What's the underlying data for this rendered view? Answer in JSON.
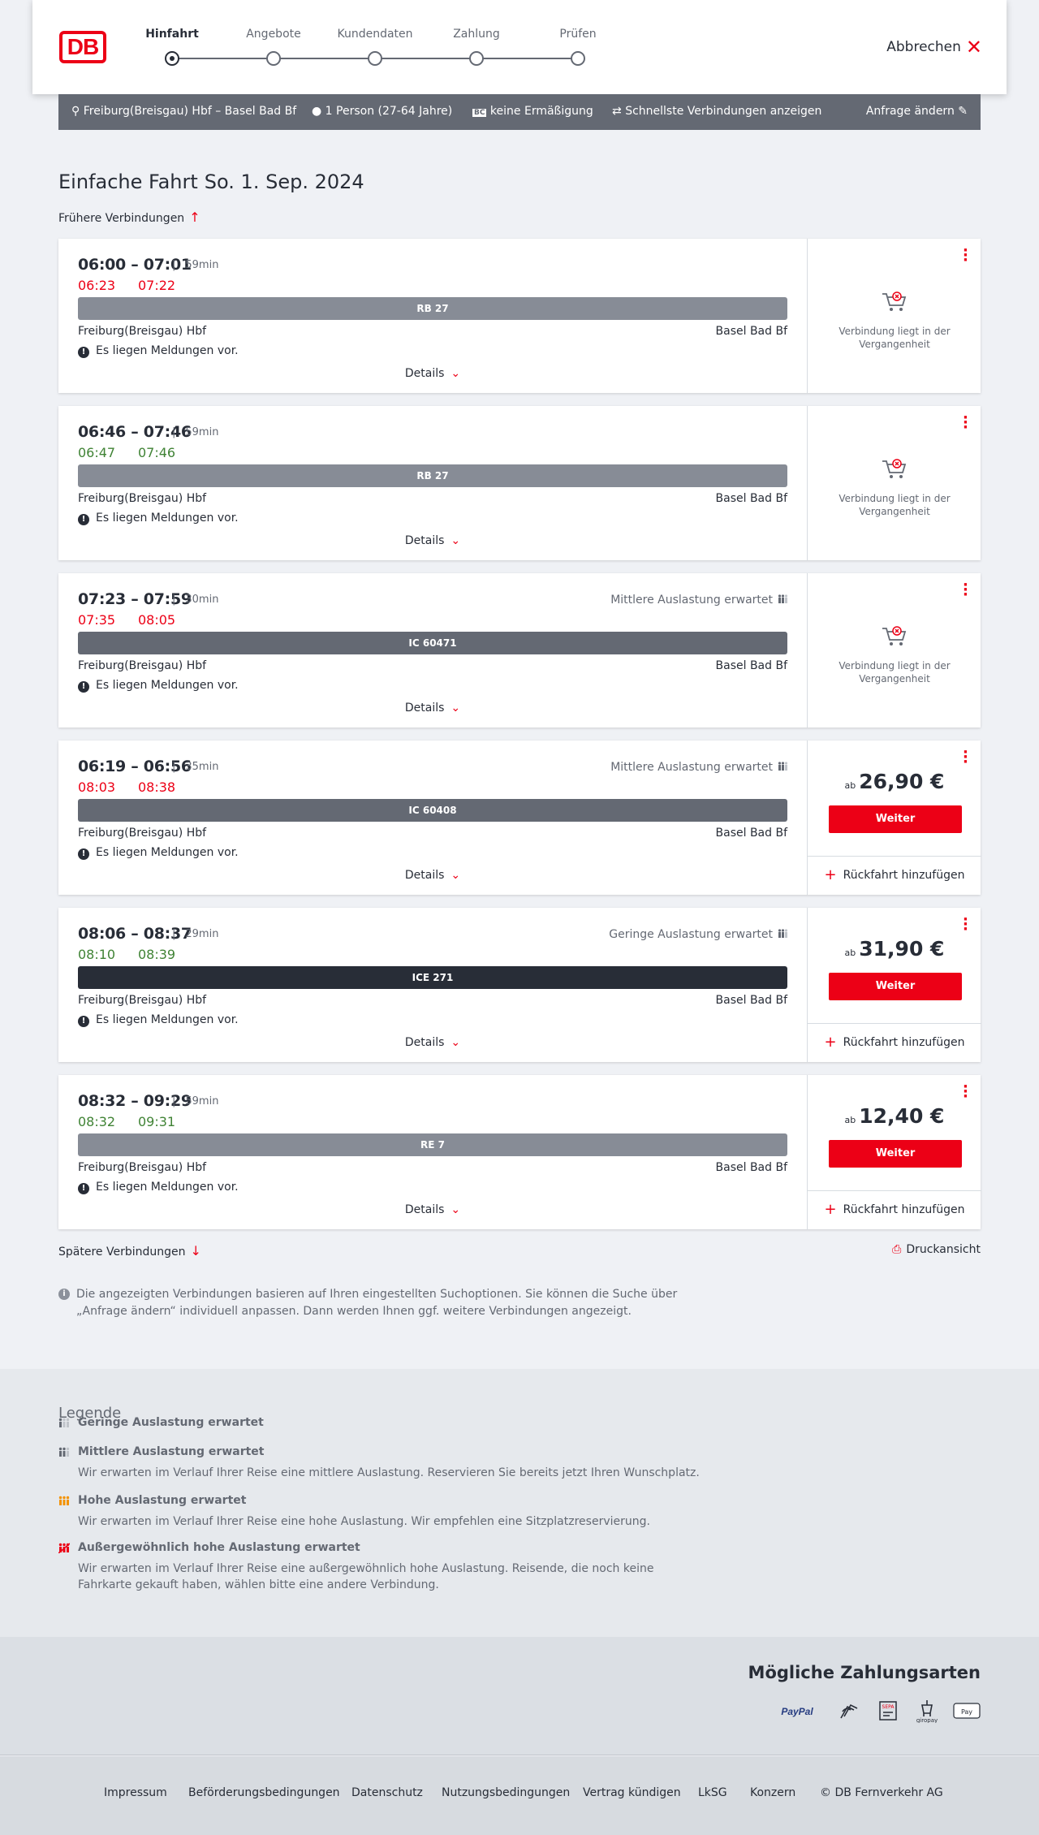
{
  "header": {
    "logo": "DB",
    "steps": [
      {
        "label": "Hinfahrt",
        "active": true
      },
      {
        "label": "Angebote",
        "active": false
      },
      {
        "label": "Kundendaten",
        "active": false
      },
      {
        "label": "Zahlung",
        "active": false
      },
      {
        "label": "Prüfen",
        "active": false
      }
    ],
    "cancel_label": "Abbrechen"
  },
  "search_bar": {
    "route": "Freiburg(Breisgau) Hbf – Basel Bad Bf",
    "passengers": "1 Person (27-64 Jahre)",
    "discount": "keine Ermäßigung",
    "fastest": "Schnellste Verbindungen anzeigen",
    "change": "Anfrage ändern"
  },
  "page": {
    "title": "Einfache Fahrt",
    "date": "So. 1. Sep. 2024",
    "earlier": "Frühere Verbindungen",
    "later": "Spätere Verbindungen",
    "print": "Druckansicht",
    "info": "Die angezeigten Verbindungen basieren auf Ihren eingestellten Suchoptionen. Sie können die Suche über „Anfrage ändern“ individuell anpassen. Dann werden Ihnen ggf. weitere Verbindungen angezeigt."
  },
  "connections": [
    {
      "times": "06:00 – 07:01",
      "duration": "59min",
      "rt_dep": "06:23",
      "rt_arr": "07:22",
      "rt_status": "late",
      "load": "",
      "train": "RB 27",
      "train_color": "#878c96",
      "from": "Freiburg(Breisgau) Hbf",
      "to": "Basel Bad Bf",
      "message": "Es liegen Meldungen vor.",
      "details": "Details",
      "past_text": "Verbindung liegt in der Vergangenheit"
    },
    {
      "times": "06:46 – 07:46",
      "duration": "59min",
      "rt_dep": "06:47",
      "rt_arr": "07:46",
      "rt_status": "ontime",
      "load": "",
      "train": "RB 27",
      "train_color": "#878c96",
      "from": "Freiburg(Breisgau) Hbf",
      "to": "Basel Bad Bf",
      "message": "Es liegen Meldungen vor.",
      "details": "Details",
      "past_text": "Verbindung liegt in der Vergangenheit"
    },
    {
      "times": "07:23 – 07:59",
      "duration": "30min",
      "rt_dep": "07:35",
      "rt_arr": "08:05",
      "rt_status": "late",
      "load": "Mittlere Auslastung erwartet",
      "train": "IC 60471",
      "train_color": "#646973",
      "from": "Freiburg(Breisgau) Hbf",
      "to": "Basel Bad Bf",
      "message": "Es liegen Meldungen vor.",
      "details": "Details",
      "past_text": "Verbindung liegt in der Vergangenheit"
    },
    {
      "times": "06:19 – 06:56",
      "duration": "35min",
      "rt_dep": "08:03",
      "rt_arr": "08:38",
      "rt_status": "late",
      "load": "Mittlere Auslastung erwartet",
      "train": "IC 60408",
      "train_color": "#646973",
      "from": "Freiburg(Breisgau) Hbf",
      "to": "Basel Bad Bf",
      "message": "Es liegen Meldungen vor.",
      "details": "Details",
      "price_prefix": "ab",
      "price": "26,90 €",
      "book": "Weiter",
      "return": "Rückfahrt hinzufügen"
    },
    {
      "times": "08:06 – 08:37",
      "duration": "29min",
      "rt_dep": "08:10",
      "rt_arr": "08:39",
      "rt_status": "ontime",
      "load": "Geringe Auslastung erwartet",
      "train": "ICE 271",
      "train_color": "#282d37",
      "from": "Freiburg(Breisgau) Hbf",
      "to": "Basel Bad Bf",
      "message": "Es liegen Meldungen vor.",
      "details": "Details",
      "price_prefix": "ab",
      "price": "31,90 €",
      "book": "Weiter",
      "return": "Rückfahrt hinzufügen"
    },
    {
      "times": "08:32 – 09:29",
      "duration": "59min",
      "rt_dep": "08:32",
      "rt_arr": "09:31",
      "rt_status": "ontime",
      "load": "",
      "train": "RE 7",
      "train_color": "#878c96",
      "from": "Freiburg(Breisgau) Hbf",
      "to": "Basel Bad Bf",
      "message": "Es liegen Meldungen vor.",
      "details": "Details",
      "price_prefix": "ab",
      "price": "12,40 €",
      "book": "Weiter",
      "return": "Rückfahrt hinzufügen"
    }
  ],
  "legend": {
    "title": "Legende",
    "items": [
      {
        "title": "Geringe Auslastung erwartet",
        "text": "",
        "color": "#646973",
        "level": 1
      },
      {
        "title": "Mittlere Auslastung erwartet",
        "text": "Wir erwarten im Verlauf Ihrer Reise eine mittlere Auslastung. Reservieren Sie bereits jetzt Ihren Wunschplatz.",
        "color": "#646973",
        "level": 2
      },
      {
        "title": "Hohe Auslastung erwartet",
        "text": "Wir erwarten im Verlauf Ihrer Reise eine hohe Auslastung. Wir empfehlen eine Sitzplatzreservierung.",
        "color": "#f39200",
        "level": 3
      },
      {
        "title": "Außergewöhnlich hohe Auslastung erwartet",
        "text": "Wir erwarten im Verlauf Ihrer Reise eine außergewöhnlich hohe Auslastung. Reisende, die noch keine Fahrkarte gekauft haben, wählen bitte eine andere Verbindung.",
        "color": "#ec0016",
        "level": 4
      }
    ]
  },
  "payment": {
    "title": "Mögliche Zahlungsarten",
    "methods": [
      "PayPal",
      "Kreditkarte",
      "SEPA",
      "giropay",
      "Pay"
    ]
  },
  "footer": {
    "links": [
      "Impressum",
      "Beförderungsbedingungen",
      "Datenschutz",
      "Nutzungsbedingungen",
      "Vertrag kündigen",
      "LkSG",
      "Konzern",
      "© DB Fernverkehr AG"
    ]
  },
  "colors": {
    "accent": "#ec0016",
    "late": "#ec0016",
    "ontime": "#408335",
    "dark": "#282d37"
  }
}
